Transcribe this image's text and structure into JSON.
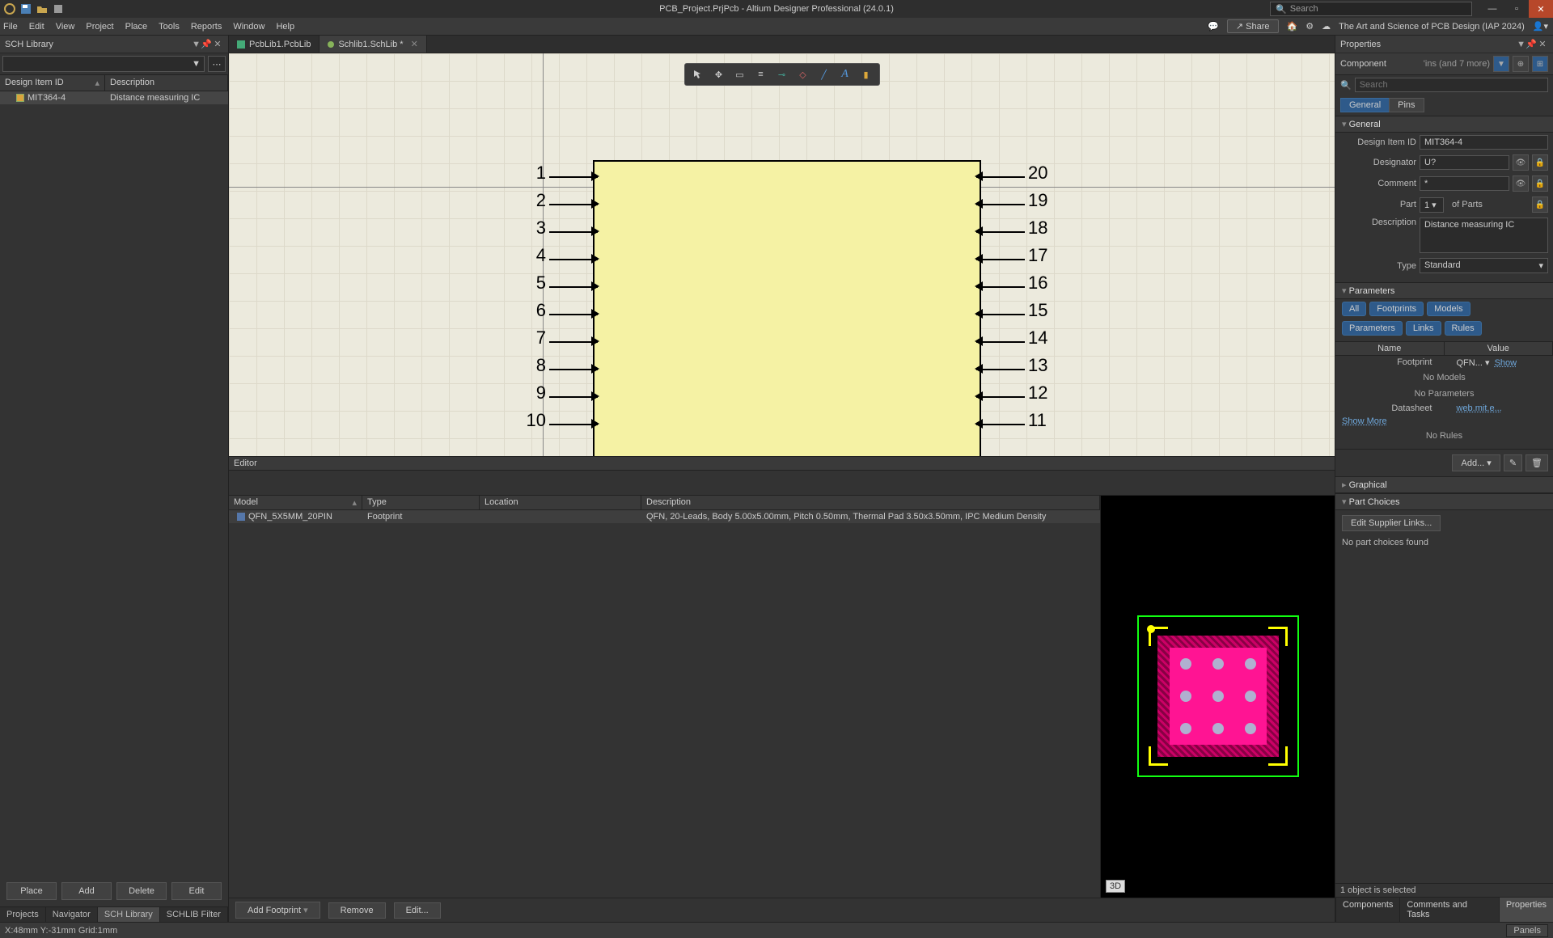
{
  "title": "PCB_Project.PrjPcb - Altium Designer Professional (24.0.1)",
  "search_placeholder": "Search",
  "menu": {
    "file": "File",
    "edit": "Edit",
    "view": "View",
    "project": "Project",
    "place": "Place",
    "tools": "Tools",
    "reports": "Reports",
    "window": "Window",
    "help": "Help"
  },
  "share": "Share",
  "course": "The Art and Science of PCB Design (IAP 2024)",
  "left": {
    "title": "SCH Library",
    "columns": {
      "id": "Design Item ID",
      "desc": "Description"
    },
    "rows": [
      {
        "id": "MIT364-4",
        "desc": "Distance measuring IC"
      }
    ],
    "buttons": {
      "place": "Place",
      "add": "Add",
      "delete": "Delete",
      "edit": "Edit"
    },
    "tabs": {
      "projects": "Projects",
      "navigator": "Navigator",
      "schlib": "SCH Library",
      "filter": "SCHLIB Filter"
    }
  },
  "file_tabs": [
    {
      "name": "PcbLib1.PcbLib"
    },
    {
      "name": "Schlib1.SchLib *"
    }
  ],
  "component": {
    "pins_left": [
      "1",
      "2",
      "3",
      "4",
      "5",
      "6",
      "7",
      "8",
      "9",
      "10"
    ],
    "pins_right": [
      "20",
      "19",
      "18",
      "17",
      "16",
      "15",
      "14",
      "13",
      "12",
      "11"
    ]
  },
  "editor": {
    "title": "Editor",
    "columns": {
      "model": "Model",
      "type": "Type",
      "location": "Location",
      "desc": "Description"
    },
    "row": {
      "model": "QFN_5X5MM_20PIN",
      "type": "Footprint",
      "location": "",
      "desc": "QFN, 20-Leads, Body 5.00x5.00mm, Pitch 0.50mm, Thermal Pad 3.50x3.50mm, IPC Medium Density"
    },
    "btn3d": "3D",
    "actions": {
      "addfp": "Add Footprint",
      "remove": "Remove",
      "edit": "Edit..."
    }
  },
  "props": {
    "panel_title": "Properties",
    "context": "Component",
    "context_extra": "'ins (and 7 more)",
    "search": "Search",
    "tabs": {
      "general": "General",
      "pins": "Pins"
    },
    "sections": {
      "general": "General",
      "parameters": "Parameters",
      "graphical": "Graphical",
      "part_choices": "Part Choices"
    },
    "fields": {
      "design_item": "Design Item ID",
      "designator": "Designator",
      "comment": "Comment",
      "part": "Part",
      "of_parts": "of Parts",
      "description": "Description",
      "type": "Type"
    },
    "values": {
      "design_item": "MIT364-4",
      "designator": "U?",
      "comment": "*",
      "part": "1",
      "description": "Distance measuring IC",
      "type": "Standard"
    },
    "param_pills": {
      "all": "All",
      "footprints": "Footprints",
      "models": "Models",
      "parameters": "Parameters",
      "links": "Links",
      "rules": "Rules"
    },
    "param_cols": {
      "name": "Name",
      "value": "Value"
    },
    "params": [
      {
        "name": "Footprint",
        "value": "QFN...",
        "extra": "Show"
      },
      {
        "name": "Datasheet",
        "value": "web.mit.e..."
      }
    ],
    "no_models": "No Models",
    "no_params": "No Parameters",
    "show_more": "Show More",
    "no_rules": "No Rules",
    "add": "Add...",
    "edit_supplier": "Edit Supplier Links...",
    "no_choices": "No part choices found",
    "selected": "1 object is selected",
    "bottom_tabs": {
      "components": "Components",
      "comments": "Comments and Tasks",
      "properties": "Properties"
    }
  },
  "status": {
    "coords": "X:48mm Y:-31mm   Grid:1mm",
    "panels": "Panels"
  }
}
